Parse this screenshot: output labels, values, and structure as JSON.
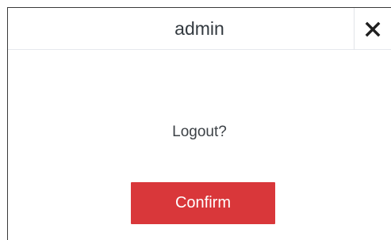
{
  "dialog": {
    "title": "admin",
    "close_icon": "close-icon",
    "message": "Logout?",
    "confirm_label": "Confirm"
  },
  "colors": {
    "confirm_button": "#d9373a",
    "title_text": "#333a40",
    "divider": "#e6e9ee"
  }
}
